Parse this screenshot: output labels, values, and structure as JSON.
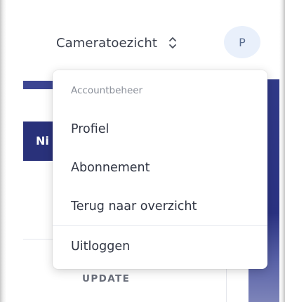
{
  "header": {
    "camera_selector_label": "Cameratoezicht",
    "selector_icon": "unfold-up-down-icon",
    "avatar_initial": "P"
  },
  "background": {
    "table_header_text": "Ni",
    "update_link": "UPDATE"
  },
  "account_menu": {
    "section_title": "Accountbeheer",
    "items": [
      {
        "label": "Profiel"
      },
      {
        "label": "Abonnement"
      },
      {
        "label": "Terug naar overzicht"
      }
    ],
    "logout_label": "Uitloggen"
  },
  "colors": {
    "brand_navy": "#29317a",
    "avatar_bg": "#e9f0fb",
    "avatar_text": "#5b6e90",
    "muted_text": "#8a8f99"
  }
}
